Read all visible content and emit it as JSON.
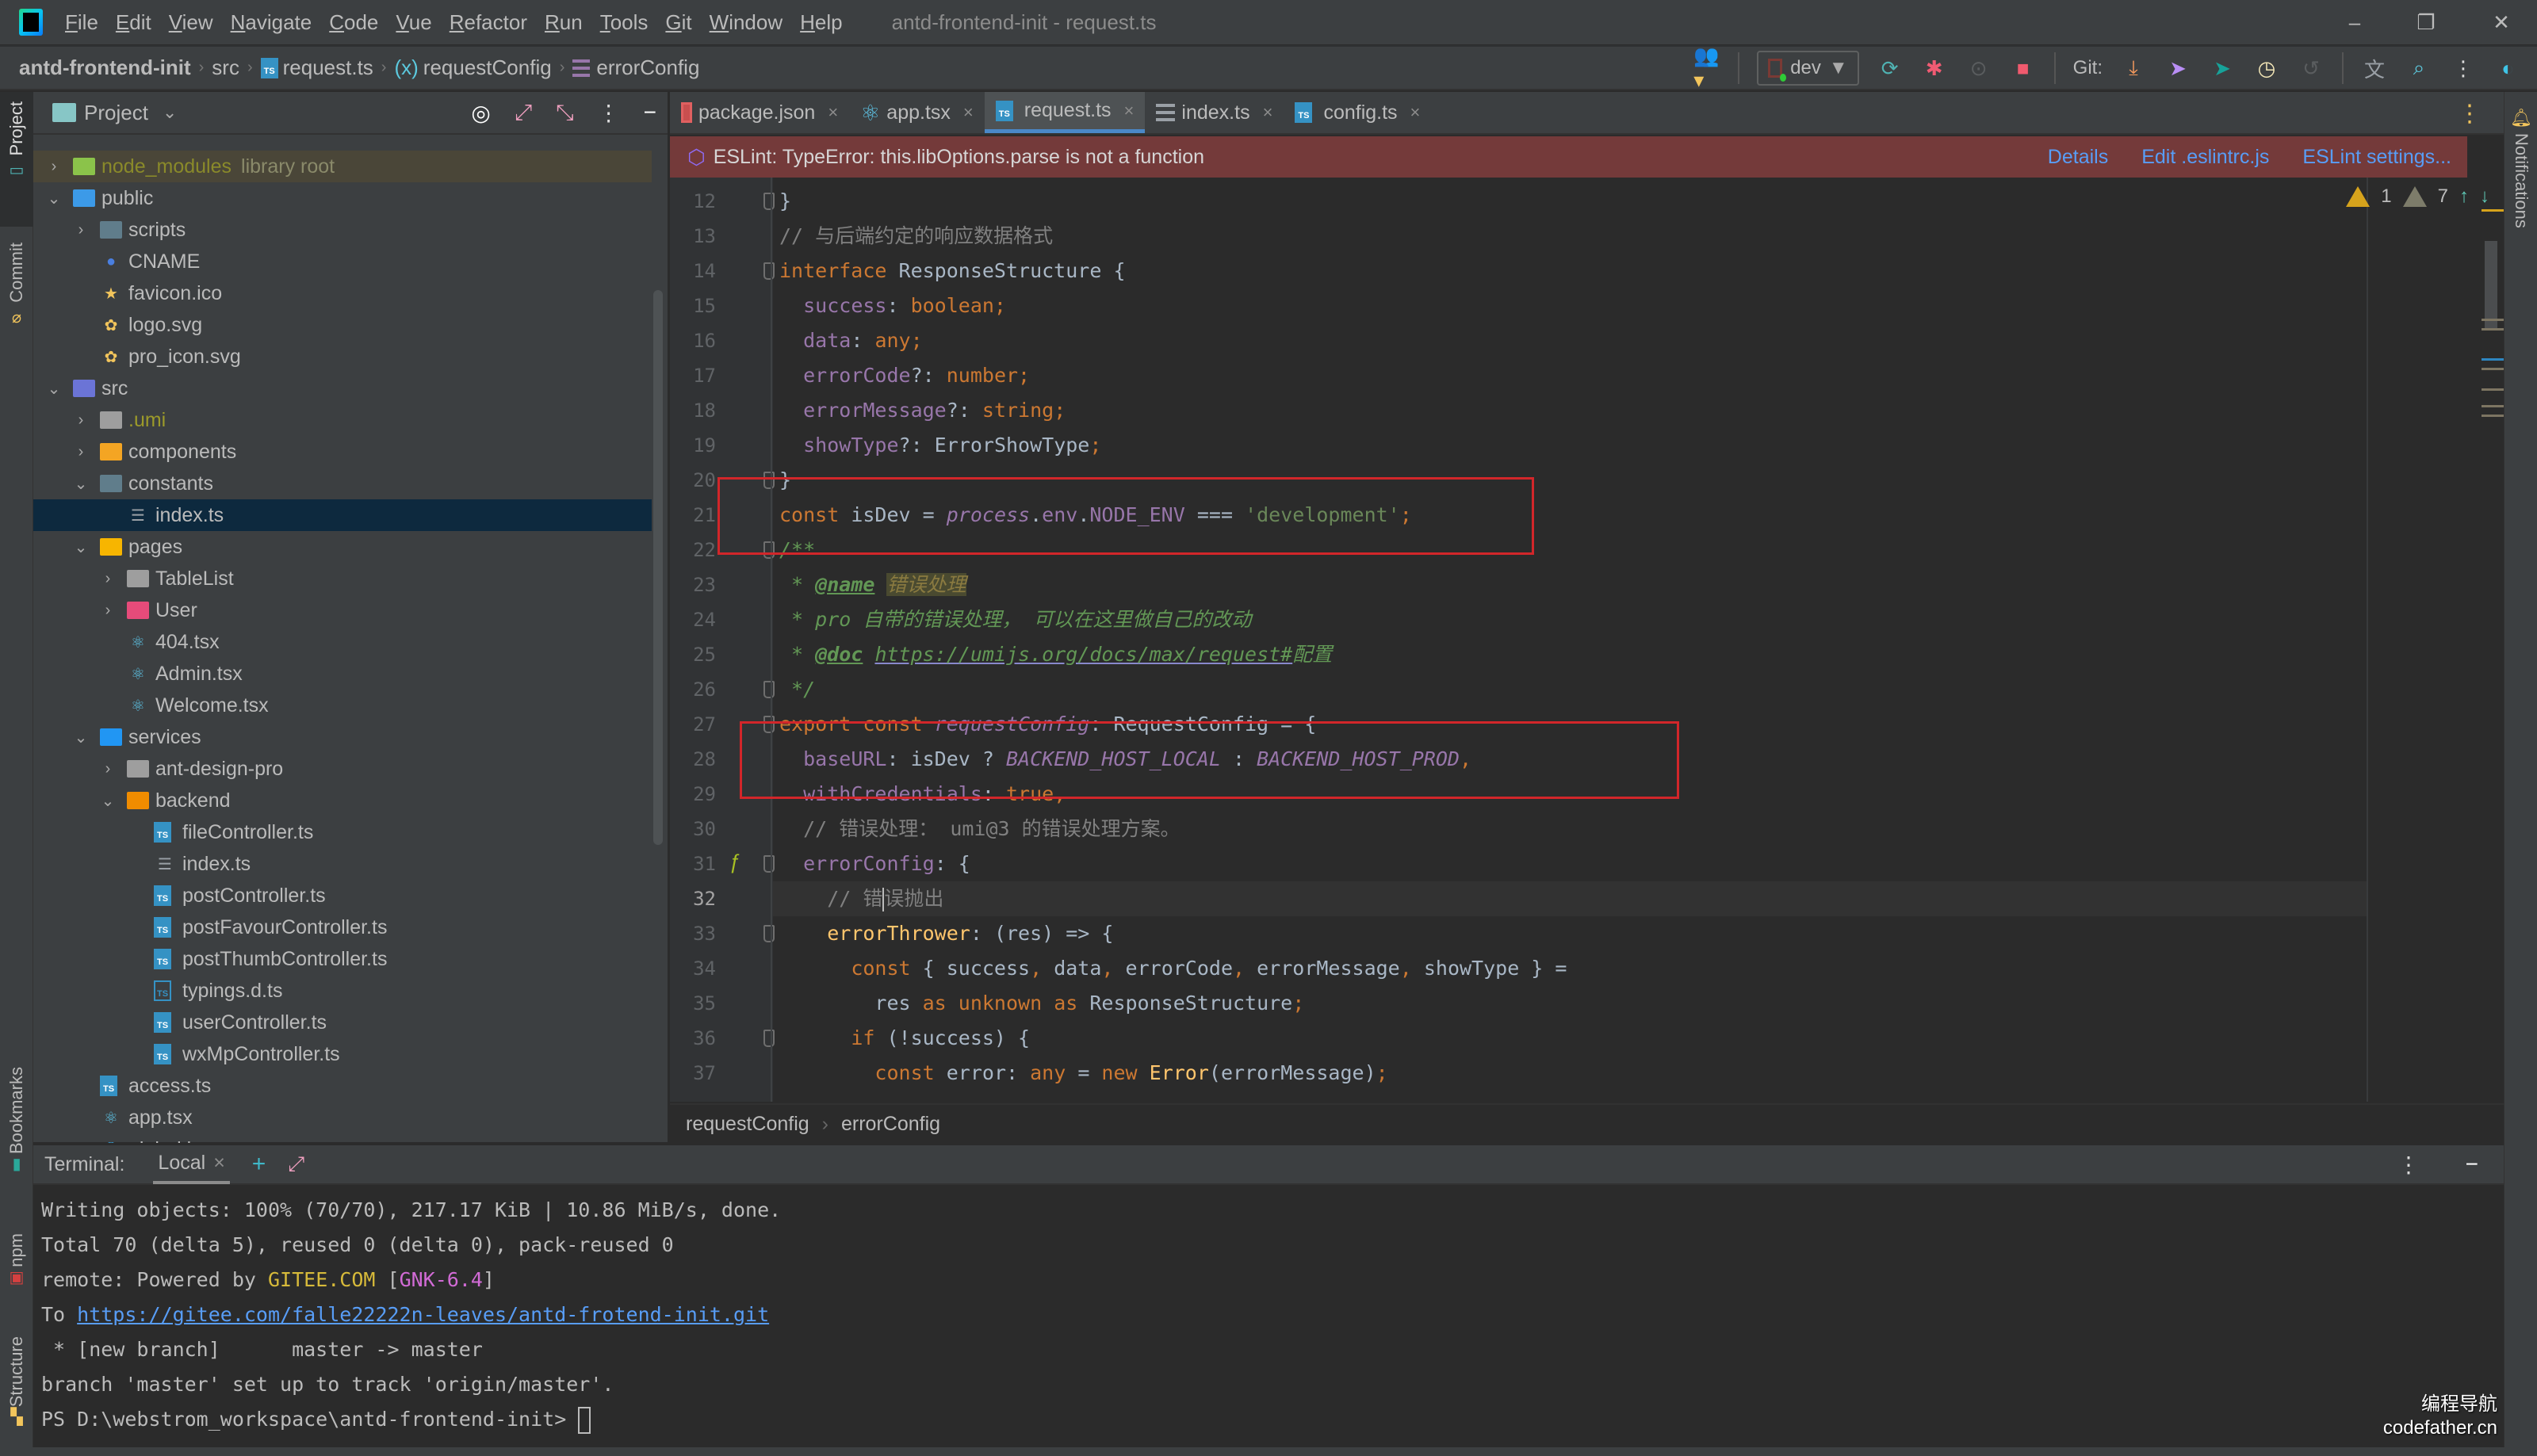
{
  "app": {
    "window_title": "antd-frontend-init - request.ts",
    "menu": [
      "File",
      "Edit",
      "View",
      "Navigate",
      "Code",
      "Vue",
      "Refactor",
      "Run",
      "Tools",
      "Git",
      "Window",
      "Help"
    ],
    "window_controls": {
      "minimize": "‒",
      "restore": "❐",
      "close": "✕"
    }
  },
  "navbar": {
    "crumbs": [
      "antd-frontend-init",
      "src",
      "request.ts",
      "requestConfig",
      "errorConfig"
    ],
    "run_config": "dev",
    "git_label": "Git:"
  },
  "left_strip": {
    "tabs": [
      "Project",
      "Commit",
      "Bookmarks",
      "npm",
      "Structure"
    ]
  },
  "right_strip": {
    "tabs": [
      "Notifications"
    ]
  },
  "project": {
    "title": "Project",
    "tree": [
      {
        "label": "node_modules",
        "note": "library root",
        "depth": 0,
        "state": "collapsed",
        "icon": "node-modules-folder",
        "style": "lib"
      },
      {
        "label": "public",
        "depth": 0,
        "state": "expanded",
        "icon": "web-folder"
      },
      {
        "label": "scripts",
        "depth": 1,
        "state": "collapsed",
        "icon": "scripts-folder"
      },
      {
        "label": "CNAME",
        "depth": 1,
        "icon": "globe"
      },
      {
        "label": "favicon.ico",
        "depth": 1,
        "icon": "star"
      },
      {
        "label": "logo.svg",
        "depth": 1,
        "icon": "svg"
      },
      {
        "label": "pro_icon.svg",
        "depth": 1,
        "icon": "svg"
      },
      {
        "label": "src",
        "depth": 0,
        "state": "expanded",
        "icon": "source-folder"
      },
      {
        "label": ".umi",
        "depth": 1,
        "state": "collapsed",
        "icon": "grey-folder",
        "style": "excluded"
      },
      {
        "label": "components",
        "depth": 1,
        "state": "collapsed",
        "icon": "components-folder"
      },
      {
        "label": "constants",
        "depth": 1,
        "state": "expanded",
        "icon": "constants-folder"
      },
      {
        "label": "index.ts",
        "depth": 2,
        "icon": "index",
        "selected": true
      },
      {
        "label": "pages",
        "depth": 1,
        "state": "expanded",
        "icon": "pages-folder"
      },
      {
        "label": "TableList",
        "depth": 2,
        "state": "collapsed",
        "icon": "grey-folder"
      },
      {
        "label": "User",
        "depth": 2,
        "state": "collapsed",
        "icon": "user-folder"
      },
      {
        "label": "404.tsx",
        "depth": 2,
        "icon": "react"
      },
      {
        "label": "Admin.tsx",
        "depth": 2,
        "icon": "react"
      },
      {
        "label": "Welcome.tsx",
        "depth": 2,
        "icon": "react"
      },
      {
        "label": "services",
        "depth": 1,
        "state": "expanded",
        "icon": "services-folder"
      },
      {
        "label": "ant-design-pro",
        "depth": 2,
        "state": "collapsed",
        "icon": "grey-folder"
      },
      {
        "label": "backend",
        "depth": 2,
        "state": "expanded",
        "icon": "backend-folder"
      },
      {
        "label": "fileController.ts",
        "depth": 3,
        "icon": "ts"
      },
      {
        "label": "index.ts",
        "depth": 3,
        "icon": "index"
      },
      {
        "label": "postController.ts",
        "depth": 3,
        "icon": "ts"
      },
      {
        "label": "postFavourController.ts",
        "depth": 3,
        "icon": "ts"
      },
      {
        "label": "postThumbController.ts",
        "depth": 3,
        "icon": "ts"
      },
      {
        "label": "typings.d.ts",
        "depth": 3,
        "icon": "ts-outline"
      },
      {
        "label": "userController.ts",
        "depth": 3,
        "icon": "ts"
      },
      {
        "label": "wxMpController.ts",
        "depth": 3,
        "icon": "ts"
      },
      {
        "label": "access.ts",
        "depth": 1,
        "icon": "ts"
      },
      {
        "label": "app.tsx",
        "depth": 1,
        "icon": "react"
      },
      {
        "label": "global.less",
        "depth": 1,
        "icon": "less"
      }
    ]
  },
  "editor": {
    "tabs": [
      {
        "label": "package.json",
        "icon": "json",
        "active": false
      },
      {
        "label": "app.tsx",
        "icon": "react",
        "active": false
      },
      {
        "label": "request.ts",
        "icon": "ts",
        "active": true
      },
      {
        "label": "index.ts",
        "icon": "index",
        "active": false
      },
      {
        "label": "config.ts",
        "icon": "ts",
        "active": false
      }
    ],
    "eslint_banner": {
      "message": "ESLint: TypeError: this.libOptions.parse is not a function",
      "links": [
        "Details",
        "Edit .eslintrc.js",
        "ESLint settings..."
      ]
    },
    "inspections": {
      "warnings": "1",
      "weak_warnings": "7"
    },
    "current_line": 32,
    "lines": [
      {
        "n": 12,
        "tokens": [
          [
            "p",
            "}"
          ]
        ]
      },
      {
        "n": 13,
        "tokens": [
          [
            "cmt",
            "// 与后端约定的响应数据格式"
          ]
        ]
      },
      {
        "n": 14,
        "tokens": [
          [
            "kw",
            "interface"
          ],
          [
            "p",
            " ResponseStructure {"
          ]
        ]
      },
      {
        "n": 15,
        "tokens": [
          [
            "p",
            "  "
          ],
          [
            "prop",
            "success"
          ],
          [
            "p",
            ": "
          ],
          [
            "kw",
            "boolean;"
          ]
        ]
      },
      {
        "n": 16,
        "tokens": [
          [
            "p",
            "  "
          ],
          [
            "prop",
            "data"
          ],
          [
            "p",
            ": "
          ],
          [
            "kw",
            "any;"
          ]
        ]
      },
      {
        "n": 17,
        "tokens": [
          [
            "p",
            "  "
          ],
          [
            "prop",
            "errorCode"
          ],
          [
            "p",
            "?: "
          ],
          [
            "kw",
            "number;"
          ]
        ]
      },
      {
        "n": 18,
        "tokens": [
          [
            "p",
            "  "
          ],
          [
            "prop",
            "errorMessage"
          ],
          [
            "p",
            "?: "
          ],
          [
            "kw",
            "string;"
          ]
        ]
      },
      {
        "n": 19,
        "tokens": [
          [
            "p",
            "  "
          ],
          [
            "prop",
            "showType"
          ],
          [
            "p",
            "?: ErrorShowType"
          ],
          [
            "kw",
            ";"
          ]
        ]
      },
      {
        "n": 20,
        "tokens": [
          [
            "p",
            "}"
          ]
        ]
      },
      {
        "n": 21,
        "tokens": [
          [
            "kw",
            "const"
          ],
          [
            "p",
            " isDev = "
          ],
          [
            "propi",
            "process"
          ],
          [
            "p",
            "."
          ],
          [
            "prop",
            "env"
          ],
          [
            "p",
            "."
          ],
          [
            "prop",
            "NODE_ENV"
          ],
          [
            "p",
            " === "
          ],
          [
            "str",
            "'development'"
          ],
          [
            "kw",
            ";"
          ]
        ]
      },
      {
        "n": 22,
        "tokens": [
          [
            "doc",
            "/**"
          ]
        ]
      },
      {
        "n": 23,
        "tokens": [
          [
            "doc",
            " * "
          ],
          [
            "doctag",
            "@name"
          ],
          [
            "p",
            " "
          ],
          [
            "docval",
            "错误处理"
          ]
        ]
      },
      {
        "n": 24,
        "tokens": [
          [
            "doc",
            " * pro 自带的错误处理， 可以在这里做自己的改动"
          ]
        ]
      },
      {
        "n": 25,
        "tokens": [
          [
            "doc",
            " * "
          ],
          [
            "doctag",
            "@doc"
          ],
          [
            "p",
            " "
          ],
          [
            "url",
            "https://umijs.org/docs/max/request#"
          ],
          [
            "doc",
            "配置"
          ]
        ]
      },
      {
        "n": 26,
        "tokens": [
          [
            "doc",
            " */"
          ]
        ]
      },
      {
        "n": 27,
        "tokens": [
          [
            "kw",
            "export const "
          ],
          [
            "propi",
            "requestConfig"
          ],
          [
            "p",
            ": RequestConfig = {"
          ]
        ]
      },
      {
        "n": 28,
        "tokens": [
          [
            "p",
            "  "
          ],
          [
            "prop",
            "baseURL"
          ],
          [
            "p",
            ": isDev ? "
          ],
          [
            "propi",
            "BACKEND_HOST_LOCAL"
          ],
          [
            "p",
            " : "
          ],
          [
            "propi",
            "BACKEND_HOST_PROD"
          ],
          [
            "kw",
            ","
          ]
        ]
      },
      {
        "n": 29,
        "tokens": [
          [
            "p",
            "  "
          ],
          [
            "prop",
            "withCredentials"
          ],
          [
            "p",
            ": "
          ],
          [
            "kw",
            "true,"
          ]
        ]
      },
      {
        "n": 30,
        "tokens": [
          [
            "p",
            "  "
          ],
          [
            "cmt",
            "// 错误处理： umi@3 的错误处理方案。"
          ]
        ]
      },
      {
        "n": 31,
        "tokens": [
          [
            "p",
            "  "
          ],
          [
            "prop",
            "errorConfig"
          ],
          [
            "p",
            ": {"
          ]
        ]
      },
      {
        "n": 32,
        "tokens": [
          [
            "p",
            "    "
          ],
          [
            "cmt",
            "// 错"
          ],
          [
            "caret",
            ""
          ],
          [
            "cmt",
            "误抛出"
          ]
        ]
      },
      {
        "n": 33,
        "tokens": [
          [
            "p",
            "    "
          ],
          [
            "fn",
            "errorThrower"
          ],
          [
            "p",
            ": (res) => {"
          ]
        ]
      },
      {
        "n": 34,
        "tokens": [
          [
            "p",
            "      "
          ],
          [
            "kw",
            "const"
          ],
          [
            "p",
            " { success"
          ],
          [
            "kw",
            ","
          ],
          [
            "p",
            " data"
          ],
          [
            "kw",
            ","
          ],
          [
            "p",
            " errorCode"
          ],
          [
            "kw",
            ","
          ],
          [
            "p",
            " errorMessage"
          ],
          [
            "kw",
            ","
          ],
          [
            "p",
            " showType } ="
          ]
        ]
      },
      {
        "n": 35,
        "tokens": [
          [
            "p",
            "        res "
          ],
          [
            "kw",
            "as unknown as"
          ],
          [
            "p",
            " ResponseStructure"
          ],
          [
            "kw",
            ";"
          ]
        ]
      },
      {
        "n": 36,
        "tokens": [
          [
            "p",
            "      "
          ],
          [
            "kw",
            "if"
          ],
          [
            "p",
            " (!success) {"
          ]
        ]
      },
      {
        "n": 37,
        "tokens": [
          [
            "p",
            "        "
          ],
          [
            "kw",
            "const"
          ],
          [
            "p",
            " error: "
          ],
          [
            "kw",
            "any"
          ],
          [
            "p",
            " = "
          ],
          [
            "kw",
            "new "
          ],
          [
            "fn",
            "Error"
          ],
          [
            "p",
            "(errorMessage)"
          ],
          [
            "kw",
            ";"
          ]
        ]
      }
    ],
    "breadcrumb": [
      "requestConfig",
      "errorConfig"
    ]
  },
  "terminal": {
    "label": "Terminal:",
    "tab": "Local",
    "lines": [
      [
        [
          "t",
          "Writing objects: 100% (70/70), 217.17 KiB | 10.86 MiB/s, done."
        ]
      ],
      [
        [
          "t",
          "Total 70 (delta 5), reused 0 (delta 0), pack-reused 0"
        ]
      ],
      [
        [
          "t",
          "remote: Powered by "
        ],
        [
          "y",
          "GITEE.COM"
        ],
        [
          "t",
          " ["
        ],
        [
          "m",
          "GNK-6.4"
        ],
        [
          "t",
          "]"
        ]
      ],
      [
        [
          "t",
          "To "
        ],
        [
          "l",
          "https://gitee.com/falle22222n-leaves/antd-frotend-init.git"
        ]
      ],
      [
        [
          "t",
          " * [new branch]      master -> master"
        ]
      ],
      [
        [
          "t",
          "branch 'master' set up to track 'origin/master'."
        ]
      ],
      [
        [
          "t",
          "PS D:\\webstrom_workspace\\antd-frontend-init> "
        ],
        [
          "cur",
          ""
        ]
      ]
    ]
  },
  "watermark": {
    "line1": "编程导航",
    "line2": "codefather.cn"
  }
}
